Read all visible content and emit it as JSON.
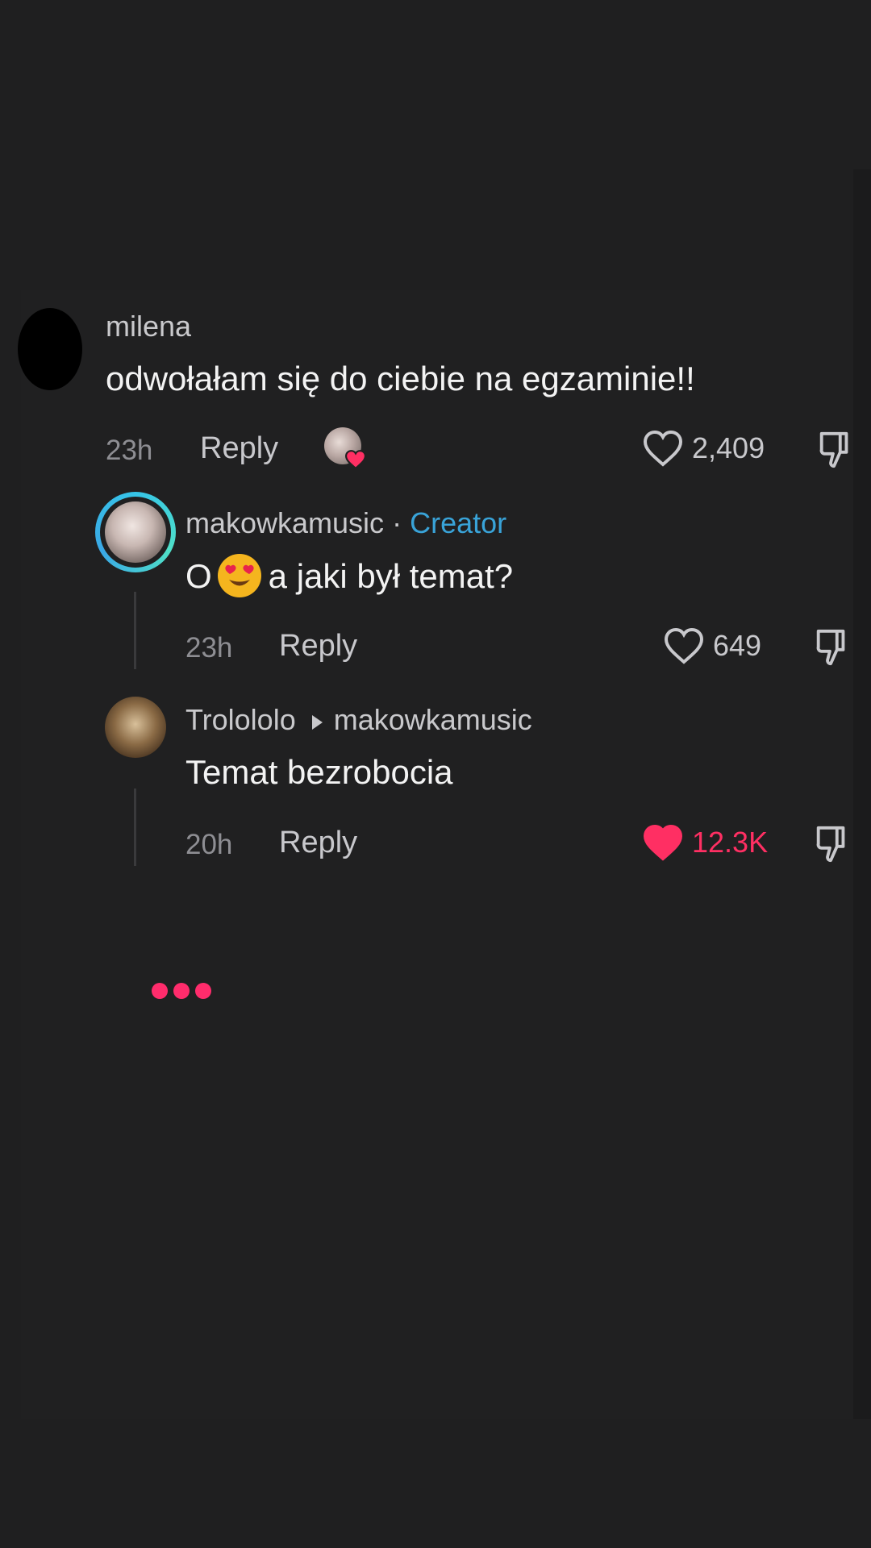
{
  "comments": [
    {
      "username": "milena",
      "text": "odwołałam się do ciebie na egzaminie!!",
      "time": "23h",
      "reply_label": "Reply",
      "likes": "2,409",
      "liked": false,
      "creator_liked": true
    }
  ],
  "replies": [
    {
      "username": "makowkamusic",
      "separator": "·",
      "badge": "Creator",
      "text_prefix": "O",
      "emoji": "heart-eyes",
      "text_suffix": "a jaki był temat?",
      "time": "23h",
      "reply_label": "Reply",
      "likes": "649",
      "liked": false
    },
    {
      "username": "Trolololo",
      "replying_to": "makowkamusic",
      "text": "Temat bezrobocia",
      "time": "20h",
      "reply_label": "Reply",
      "likes": "12.3K",
      "liked": true
    }
  ],
  "colors": {
    "background": "#1f1f20",
    "creator_badge": "#39a3d8",
    "liked": "#ff2f63",
    "loading_dots": "#ff2c6c"
  },
  "icons": [
    "heart-outline-icon",
    "heart-filled-icon",
    "dislike-icon",
    "play-arrow-icon",
    "loading-dots"
  ]
}
